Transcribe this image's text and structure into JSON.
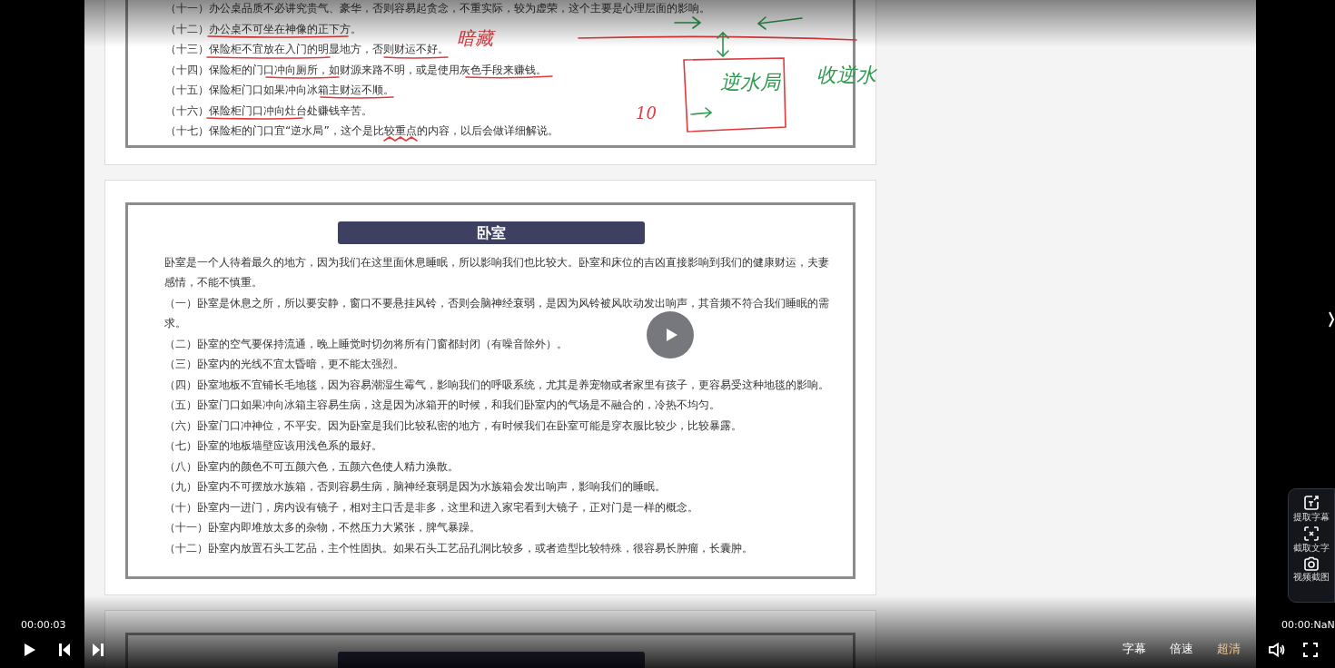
{
  "player": {
    "elapsed": "00:00:03",
    "duration": "00:00:NaN"
  },
  "document": {
    "card_1": {
      "items": [
        "（十一）办公桌品质不必讲究贵气、豪华，否则容易起贪念，不重实际，较为虚荣，这个主要是心理层面的影响。",
        "（十二）办公桌不可坐在神像的正下方。",
        "（十三）保险柜不宜放在入门的明显地方，否则财运不好。",
        "（十四）保险柜的门口冲向厕所，如财源来路不明，或是使用灰色手段来赚钱。",
        "（十五）保险柜门口如果冲向冰箱主财运不顺。",
        "（十六）保险柜门口冲向灶台处赚钱辛苦。",
        "（十七）保险柜的门口宜“逆水局”，这个是比较重点的内容，以后会做详细解说。"
      ]
    },
    "card_2": {
      "title": "卧室",
      "paragraphs": [
        "卧室是一个人待着最久的地方，因为我们在这里面休息睡眠，所以影响我们也比较大。卧室和床位的吉凶直接影响到我们的健康财运，夫妻感情，不能不慎重。",
        "（一）卧室是休息之所，所以要安静，窗口不要悬挂风铃，否则会脑神经衰弱，是因为风铃被风吹动发出响声，其音频不符合我们睡眠的需求。",
        "（二）卧室的空气要保持流通，晚上睡觉时切勿将所有门窗都封闭（有噪音除外）。",
        "（三）卧室内的光线不宜太昏暗，更不能太强烈。",
        "（四）卧室地板不宜铺长毛地毯，因为容易潮湿生霉气，影响我们的呼吸系统，尤其是养宠物或者家里有孩子，更容易受这种地毯的影响。",
        "（五）卧室门口如果冲向冰箱主容易生病，这是因为冰箱开的时候，和我们卧室内的气场是不融合的，冷热不均匀。",
        "（六）卧室门口冲神位，不平安。因为卧室是我们比较私密的地方，有时候我们在卧室可能是穿衣服比较少，比较暴露。",
        "（七）卧室的地板墙壁应该用浅色系的最好。",
        "（八）卧室内的颜色不可五颜六色，五颜六色使人精力涣散。",
        "（九）卧室内不可摆放水族箱，否则容易生病，脑神经衰弱是因为水族箱会发出响声，影响我们的睡眠。",
        "（十）卧室内一进门，房内设有镜子，相对主口舌是非多，这里和进入家宅看到大镜子，正对门是一样的概念。",
        "（十一）卧室内即堆放太多的杂物，不然压力大紧张，脾气暴躁。",
        "（十二）卧室内放置石头工艺品，主个性固执。如果石头工艺品孔洞比较多，或者造型比较特殊，很容易长肿瘤，长囊肿。"
      ]
    }
  },
  "annotations": [
    {
      "text": "暗藏",
      "color": "#e03a3e"
    },
    {
      "text": "逆水局",
      "color": "#2e9a4e"
    },
    {
      "text": "10",
      "color": "#e03a3e"
    },
    {
      "text": "收逆水",
      "color": "#2e9a4e"
    }
  ],
  "side_tools": [
    {
      "kind": "subtitle",
      "label": "提取字幕"
    },
    {
      "kind": "text",
      "label": "截取文字"
    },
    {
      "kind": "camera",
      "label": "视频截图"
    }
  ],
  "bottom_buttons": [
    {
      "label": "字幕",
      "color": "#ffffff"
    },
    {
      "label": "倍速",
      "color": "#ffffff"
    },
    {
      "label": "超清",
      "color": "#f2c68c"
    }
  ]
}
